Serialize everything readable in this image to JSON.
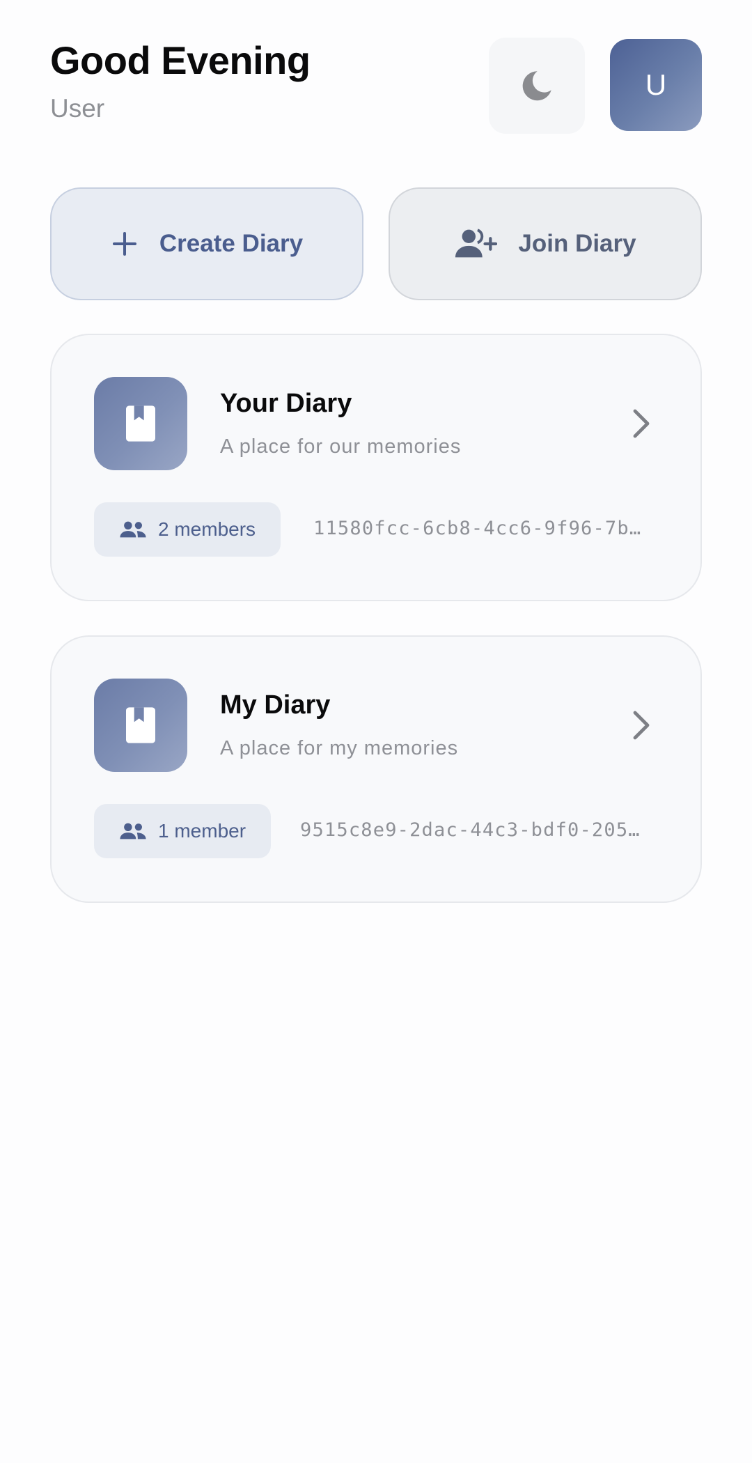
{
  "header": {
    "greeting": "Good Evening",
    "username": "User",
    "theme_toggle_icon": "moon-icon",
    "avatar_initial": "U"
  },
  "actions": {
    "create_label": "Create Diary",
    "create_icon": "plus-icon",
    "join_label": "Join Diary",
    "join_icon": "add-person-icon"
  },
  "diaries": [
    {
      "title": "Your Diary",
      "description": "A place for our memories",
      "members_label": "2 members",
      "id": "11580fcc-6cb8-4cc6-9f96-7b…",
      "icon": "book-icon"
    },
    {
      "title": "My Diary",
      "description": "A place for my memories",
      "members_label": "1 member",
      "id": "9515c8e9-2dac-44c3-bdf0-205…",
      "icon": "book-icon"
    }
  ],
  "colors": {
    "accent": "#4a5d8e",
    "avatar_bg": "#5a6d9e",
    "card_bg": "#f8f9fb",
    "muted_text": "#8e9096"
  }
}
